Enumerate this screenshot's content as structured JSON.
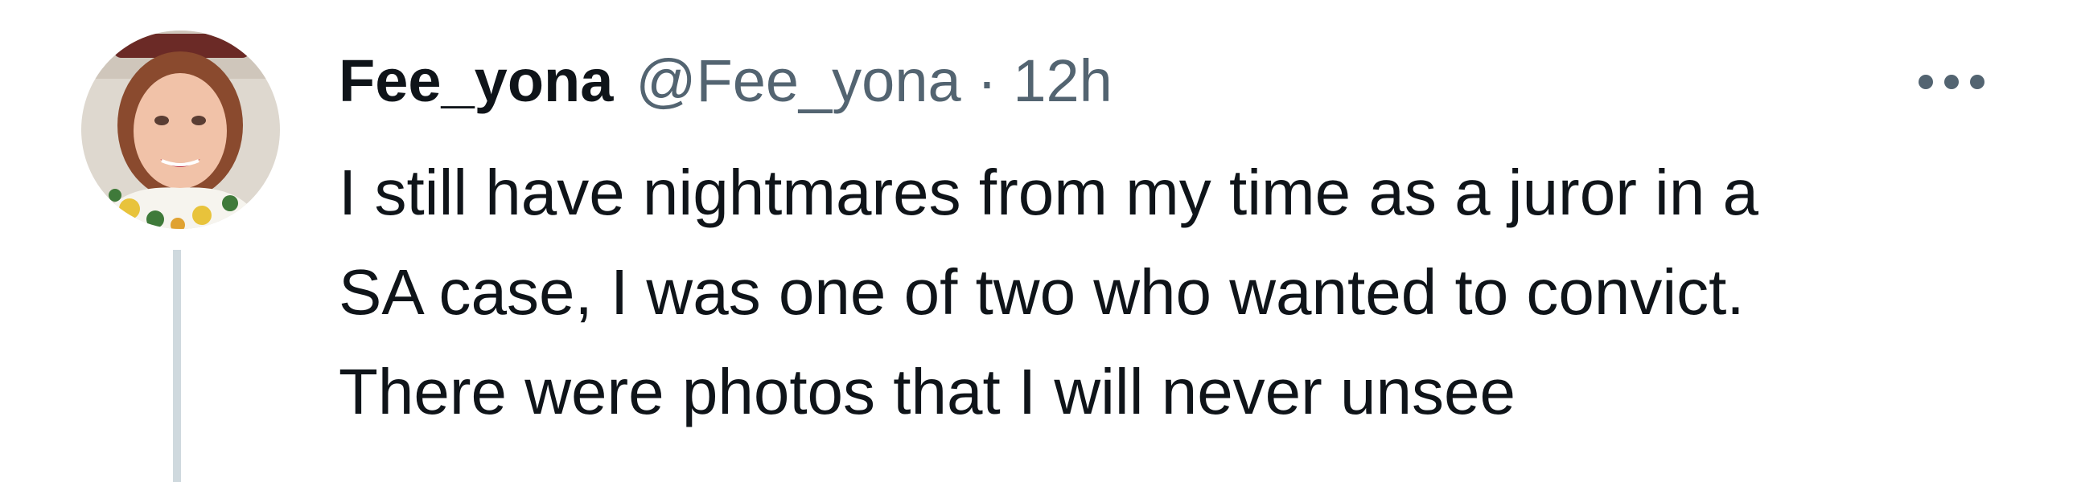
{
  "tweet": {
    "author": {
      "display_name": "Fee_yona",
      "handle": "@Fee_yona",
      "avatar_icon": "profile-photo"
    },
    "separator": "·",
    "time": "12h",
    "more_icon": "more-horizontal-icon",
    "text": "I still have nightmares from my time as a juror in a\nSA case, I was one of two who wanted to convict.\nThere were photos that I will never unsee",
    "colors": {
      "text": "#0f1419",
      "secondary_text": "#536471",
      "thread_line": "#cfd9de",
      "background": "#ffffff"
    }
  }
}
